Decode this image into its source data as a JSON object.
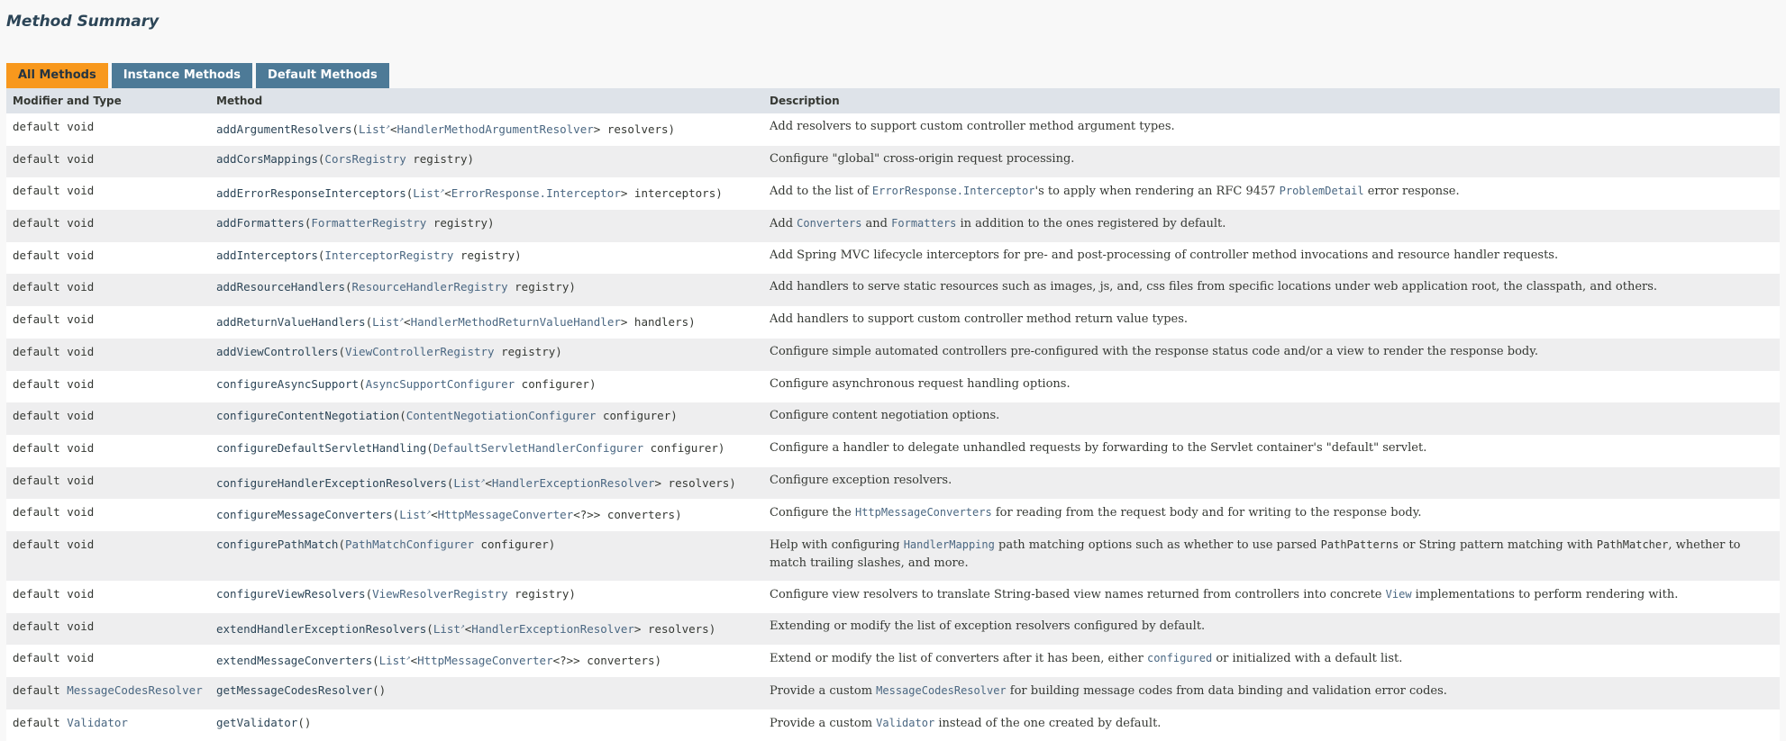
{
  "title": "Method Summary",
  "tabs": [
    {
      "label": "All Methods"
    },
    {
      "label": "Instance Methods"
    },
    {
      "label": "Default Methods"
    }
  ],
  "columns": [
    "Modifier and Type",
    "Method",
    "Description"
  ],
  "rows": [
    {
      "mod": [
        {
          "t": "default void"
        }
      ],
      "method": [
        {
          "t": "addArgumentResolvers",
          "k": "name"
        },
        {
          "t": "("
        },
        {
          "t": "List",
          "k": "link"
        },
        {
          "t": "↗",
          "k": "ext"
        },
        {
          "t": "<"
        },
        {
          "t": "HandlerMethodArgumentResolver",
          "k": "link"
        },
        {
          "t": "> resolvers)"
        }
      ],
      "desc": [
        {
          "t": "Add resolvers to support custom controller method argument types."
        }
      ]
    },
    {
      "mod": [
        {
          "t": "default void"
        }
      ],
      "method": [
        {
          "t": "addCorsMappings",
          "k": "name"
        },
        {
          "t": "("
        },
        {
          "t": "CorsRegistry",
          "k": "link"
        },
        {
          "t": " registry)"
        }
      ],
      "desc": [
        {
          "t": "Configure \"global\" cross-origin request processing."
        }
      ]
    },
    {
      "mod": [
        {
          "t": "default void"
        }
      ],
      "method": [
        {
          "t": "addErrorResponseInterceptors",
          "k": "name"
        },
        {
          "t": "("
        },
        {
          "t": "List",
          "k": "link"
        },
        {
          "t": "↗",
          "k": "ext"
        },
        {
          "t": "<"
        },
        {
          "t": "ErrorResponse.Interceptor",
          "k": "link"
        },
        {
          "t": "> interceptors)"
        }
      ],
      "desc": [
        {
          "t": "Add to the list of "
        },
        {
          "t": "ErrorResponse.Interceptor",
          "k": "code"
        },
        {
          "t": "'s to apply when rendering an RFC 9457 "
        },
        {
          "t": "ProblemDetail",
          "k": "code"
        },
        {
          "t": " error response."
        }
      ]
    },
    {
      "mod": [
        {
          "t": "default void"
        }
      ],
      "method": [
        {
          "t": "addFormatters",
          "k": "name"
        },
        {
          "t": "("
        },
        {
          "t": "FormatterRegistry",
          "k": "link"
        },
        {
          "t": " registry)"
        }
      ],
      "desc": [
        {
          "t": "Add "
        },
        {
          "t": "Converters",
          "k": "code"
        },
        {
          "t": " and "
        },
        {
          "t": "Formatters",
          "k": "code"
        },
        {
          "t": " in addition to the ones registered by default."
        }
      ]
    },
    {
      "mod": [
        {
          "t": "default void"
        }
      ],
      "method": [
        {
          "t": "addInterceptors",
          "k": "name"
        },
        {
          "t": "("
        },
        {
          "t": "InterceptorRegistry",
          "k": "link"
        },
        {
          "t": " registry)"
        }
      ],
      "desc": [
        {
          "t": "Add Spring MVC lifecycle interceptors for pre- and post-processing of controller method invocations and resource handler requests."
        }
      ]
    },
    {
      "mod": [
        {
          "t": "default void"
        }
      ],
      "method": [
        {
          "t": "addResourceHandlers",
          "k": "name"
        },
        {
          "t": "("
        },
        {
          "t": "ResourceHandlerRegistry",
          "k": "link"
        },
        {
          "t": " registry)"
        }
      ],
      "desc": [
        {
          "t": "Add handlers to serve static resources such as images, js, and, css files from specific locations under web application root, the classpath, and others."
        }
      ]
    },
    {
      "mod": [
        {
          "t": "default void"
        }
      ],
      "method": [
        {
          "t": "addReturnValueHandlers",
          "k": "name"
        },
        {
          "t": "("
        },
        {
          "t": "List",
          "k": "link"
        },
        {
          "t": "↗",
          "k": "ext"
        },
        {
          "t": "<"
        },
        {
          "t": "HandlerMethodReturnValueHandler",
          "k": "link"
        },
        {
          "t": "> handlers)"
        }
      ],
      "desc": [
        {
          "t": "Add handlers to support custom controller method return value types."
        }
      ]
    },
    {
      "mod": [
        {
          "t": "default void"
        }
      ],
      "method": [
        {
          "t": "addViewControllers",
          "k": "name"
        },
        {
          "t": "("
        },
        {
          "t": "ViewControllerRegistry",
          "k": "link"
        },
        {
          "t": " registry)"
        }
      ],
      "desc": [
        {
          "t": "Configure simple automated controllers pre-configured with the response status code and/or a view to render the response body."
        }
      ]
    },
    {
      "mod": [
        {
          "t": "default void"
        }
      ],
      "method": [
        {
          "t": "configureAsyncSupport",
          "k": "name"
        },
        {
          "t": "("
        },
        {
          "t": "AsyncSupportConfigurer",
          "k": "link"
        },
        {
          "t": " configurer)"
        }
      ],
      "desc": [
        {
          "t": "Configure asynchronous request handling options."
        }
      ]
    },
    {
      "mod": [
        {
          "t": "default void"
        }
      ],
      "method": [
        {
          "t": "configureContentNegotiation",
          "k": "name"
        },
        {
          "t": "("
        },
        {
          "t": "ContentNegotiationConfigurer",
          "k": "link"
        },
        {
          "t": " configurer)"
        }
      ],
      "desc": [
        {
          "t": "Configure content negotiation options."
        }
      ]
    },
    {
      "mod": [
        {
          "t": "default void"
        }
      ],
      "method": [
        {
          "t": "configureDefaultServletHandling",
          "k": "name"
        },
        {
          "t": "("
        },
        {
          "t": "DefaultServletHandlerConfigurer",
          "k": "link"
        },
        {
          "t": " configurer)"
        }
      ],
      "desc": [
        {
          "t": "Configure a handler to delegate unhandled requests by forwarding to the Servlet container's \"default\" servlet."
        }
      ]
    },
    {
      "mod": [
        {
          "t": "default void"
        }
      ],
      "method": [
        {
          "t": "configureHandlerExceptionResolvers",
          "k": "name"
        },
        {
          "t": "("
        },
        {
          "t": "List",
          "k": "link"
        },
        {
          "t": "↗",
          "k": "ext"
        },
        {
          "t": "<"
        },
        {
          "t": "HandlerExceptionResolver",
          "k": "link"
        },
        {
          "t": "> resolvers)"
        }
      ],
      "desc": [
        {
          "t": "Configure exception resolvers."
        }
      ]
    },
    {
      "mod": [
        {
          "t": "default void"
        }
      ],
      "method": [
        {
          "t": "configureMessageConverters",
          "k": "name"
        },
        {
          "t": "("
        },
        {
          "t": "List",
          "k": "link"
        },
        {
          "t": "↗",
          "k": "ext"
        },
        {
          "t": "<"
        },
        {
          "t": "HttpMessageConverter",
          "k": "link"
        },
        {
          "t": "<?>> converters)"
        }
      ],
      "desc": [
        {
          "t": "Configure the "
        },
        {
          "t": "HttpMessageConverters",
          "k": "code"
        },
        {
          "t": " for reading from the request body and for writing to the response body."
        }
      ]
    },
    {
      "tall": true,
      "mod": [
        {
          "t": "default void"
        }
      ],
      "method": [
        {
          "t": "configurePathMatch",
          "k": "name"
        },
        {
          "t": "("
        },
        {
          "t": "PathMatchConfigurer",
          "k": "link"
        },
        {
          "t": " configurer)"
        }
      ],
      "desc": [
        {
          "t": "Help with configuring "
        },
        {
          "t": "HandlerMapping",
          "k": "code"
        },
        {
          "t": " path matching options such as whether to use parsed "
        },
        {
          "t": "PathPatterns",
          "k": "plaincode"
        },
        {
          "t": " or String pattern matching with "
        },
        {
          "t": "PathMatcher",
          "k": "plaincode"
        },
        {
          "t": ", whether to match trailing slashes, and more."
        }
      ]
    },
    {
      "mod": [
        {
          "t": "default void"
        }
      ],
      "method": [
        {
          "t": "configureViewResolvers",
          "k": "name"
        },
        {
          "t": "("
        },
        {
          "t": "ViewResolverRegistry",
          "k": "link"
        },
        {
          "t": " registry)"
        }
      ],
      "desc": [
        {
          "t": "Configure view resolvers to translate String-based view names returned from controllers into concrete "
        },
        {
          "t": "View",
          "k": "code"
        },
        {
          "t": " implementations to perform rendering with."
        }
      ]
    },
    {
      "mod": [
        {
          "t": "default void"
        }
      ],
      "method": [
        {
          "t": "extendHandlerExceptionResolvers",
          "k": "name"
        },
        {
          "t": "("
        },
        {
          "t": "List",
          "k": "link"
        },
        {
          "t": "↗",
          "k": "ext"
        },
        {
          "t": "<"
        },
        {
          "t": "HandlerExceptionResolver",
          "k": "link"
        },
        {
          "t": "> resolvers)"
        }
      ],
      "desc": [
        {
          "t": "Extending or modify the list of exception resolvers configured by default."
        }
      ]
    },
    {
      "mod": [
        {
          "t": "default void"
        }
      ],
      "method": [
        {
          "t": "extendMessageConverters",
          "k": "name"
        },
        {
          "t": "("
        },
        {
          "t": "List",
          "k": "link"
        },
        {
          "t": "↗",
          "k": "ext"
        },
        {
          "t": "<"
        },
        {
          "t": "HttpMessageConverter",
          "k": "link"
        },
        {
          "t": "<?>> converters)"
        }
      ],
      "desc": [
        {
          "t": "Extend or modify the list of converters after it has been, either "
        },
        {
          "t": "configured",
          "k": "code"
        },
        {
          "t": " or initialized with a default list."
        }
      ]
    },
    {
      "mod": [
        {
          "t": "default "
        },
        {
          "t": "MessageCodesResolver",
          "k": "link"
        }
      ],
      "method": [
        {
          "t": "getMessageCodesResolver",
          "k": "name"
        },
        {
          "t": "()"
        }
      ],
      "desc": [
        {
          "t": "Provide a custom "
        },
        {
          "t": "MessageCodesResolver",
          "k": "code"
        },
        {
          "t": " for building message codes from data binding and validation error codes."
        }
      ]
    },
    {
      "mod": [
        {
          "t": "default "
        },
        {
          "t": "Validator",
          "k": "link"
        }
      ],
      "method": [
        {
          "t": "getValidator",
          "k": "name"
        },
        {
          "t": "()"
        }
      ],
      "desc": [
        {
          "t": "Provide a custom "
        },
        {
          "t": "Validator",
          "k": "code"
        },
        {
          "t": " instead of the one created by default."
        }
      ]
    }
  ],
  "colors": {
    "active_tab": "#f8981d",
    "tab": "#4d7a97",
    "header_row": "#dee3e9",
    "link": "#4a6782"
  }
}
